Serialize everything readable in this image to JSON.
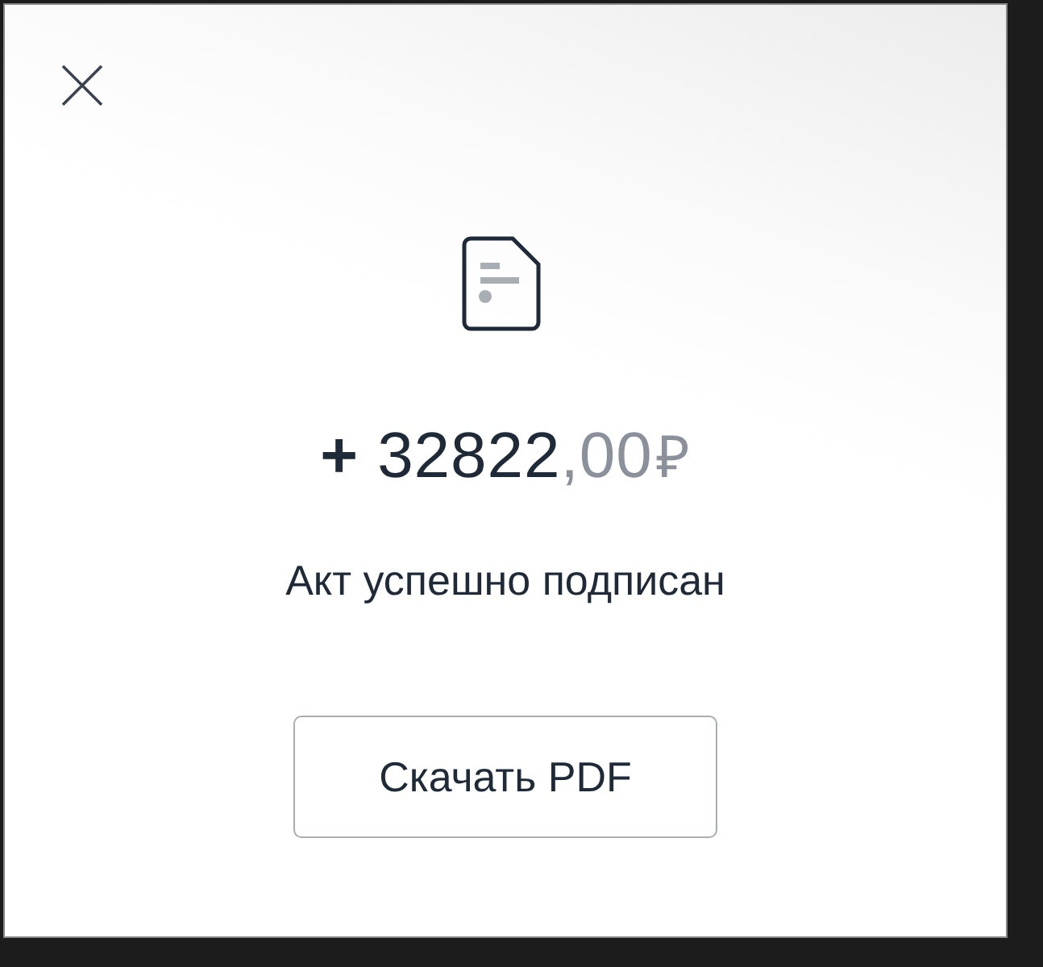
{
  "dialog": {
    "amount": {
      "sign": "+",
      "integer": "32822",
      "fraction": ",00",
      "currency": "₽"
    },
    "message": "Акт успешно подписан",
    "button": "Скачать PDF"
  }
}
